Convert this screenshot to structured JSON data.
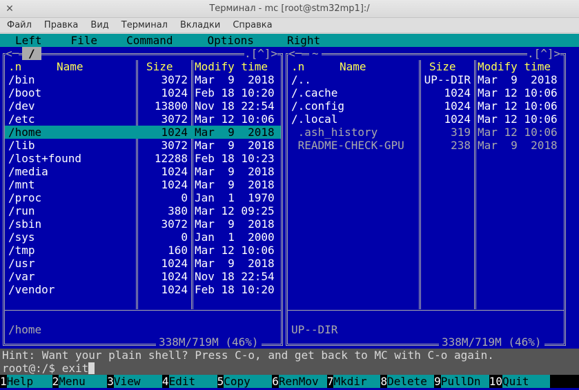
{
  "window": {
    "title": "Терминал - mc [root@stm32mp1]:/",
    "close_glyph": "✕",
    "menu": [
      "Файл",
      "Правка",
      "Вид",
      "Терминал",
      "Вкладки",
      "Справка"
    ]
  },
  "mc_menu": [
    "Left",
    "File",
    "Command",
    "Options",
    "Right"
  ],
  "left_panel": {
    "path": "/",
    "corner": ".[^]>",
    "arrow_left": "<─",
    "headers": {
      "n": ".n",
      "name": "Name",
      "size": "Size",
      "mtime": "Modify time"
    },
    "rows": [
      {
        "name": "/bin",
        "size": "3072",
        "mtime": "Mar  9  2018"
      },
      {
        "name": "/boot",
        "size": "1024",
        "mtime": "Feb 18 10:20"
      },
      {
        "name": "/dev",
        "size": "13800",
        "mtime": "Nov 18 22:54"
      },
      {
        "name": "/etc",
        "size": "3072",
        "mtime": "Mar 12 10:06"
      },
      {
        "name": "/home",
        "size": "1024",
        "mtime": "Mar  9  2018",
        "selected": true
      },
      {
        "name": "/lib",
        "size": "3072",
        "mtime": "Mar  9  2018"
      },
      {
        "name": "/lost+found",
        "size": "12288",
        "mtime": "Feb 18 10:23"
      },
      {
        "name": "/media",
        "size": "1024",
        "mtime": "Mar  9  2018"
      },
      {
        "name": "/mnt",
        "size": "1024",
        "mtime": "Mar  9  2018"
      },
      {
        "name": "/proc",
        "size": "0",
        "mtime": "Jan  1  1970"
      },
      {
        "name": "/run",
        "size": "380",
        "mtime": "Mar 12 09:25"
      },
      {
        "name": "/sbin",
        "size": "3072",
        "mtime": "Mar  9  2018"
      },
      {
        "name": "/sys",
        "size": "0",
        "mtime": "Jan  1  2000"
      },
      {
        "name": "/tmp",
        "size": "160",
        "mtime": "Mar 12 10:06"
      },
      {
        "name": "/usr",
        "size": "1024",
        "mtime": "Mar  9  2018"
      },
      {
        "name": "/var",
        "size": "1024",
        "mtime": "Nov 18 22:54"
      },
      {
        "name": "/vendor",
        "size": "1024",
        "mtime": "Feb 18 10:20"
      }
    ],
    "status": "/home",
    "disk": "338M/719M (46%)"
  },
  "right_panel": {
    "path": "~",
    "corner": ".[^]>",
    "arrow_left": "<─",
    "headers": {
      "n": ".n",
      "name": "Name",
      "size": "Size",
      "mtime": "Modify time"
    },
    "rows": [
      {
        "name": "/..",
        "size": "UP--DIR",
        "mtime": "Mar  9  2018"
      },
      {
        "name": "/.cache",
        "size": "1024",
        "mtime": "Mar 12 10:06"
      },
      {
        "name": "/.config",
        "size": "1024",
        "mtime": "Mar 12 10:06"
      },
      {
        "name": "/.local",
        "size": "1024",
        "mtime": "Mar 12 10:06"
      },
      {
        "name": " .ash_history",
        "size": "319",
        "mtime": "Mar 12 10:06",
        "dim": true
      },
      {
        "name": " README-CHECK-GPU",
        "size": "238",
        "mtime": "Mar  9  2018",
        "dim": true
      }
    ],
    "status": "UP--DIR",
    "disk": "338M/719M (46%)"
  },
  "hint": "Hint: Want your plain shell? Press C-o, and get back to MC with C-o again.",
  "shell": {
    "prompt": "root@:/$ ",
    "command": "exit"
  },
  "fkeys": [
    {
      "num": "1",
      "label": "Help"
    },
    {
      "num": "2",
      "label": "Menu"
    },
    {
      "num": "3",
      "label": "View"
    },
    {
      "num": "4",
      "label": "Edit"
    },
    {
      "num": "5",
      "label": "Copy"
    },
    {
      "num": "6",
      "label": "RenMov"
    },
    {
      "num": "7",
      "label": "Mkdir"
    },
    {
      "num": "8",
      "label": "Delete"
    },
    {
      "num": "9",
      "label": "PullDn"
    },
    {
      "num": "10",
      "label": "Quit"
    }
  ],
  "colors": {
    "panel_bg": "#0000aa",
    "accent": "#06989a",
    "header_text": "#ffff55",
    "hidden_file": "#aaaaaa"
  }
}
